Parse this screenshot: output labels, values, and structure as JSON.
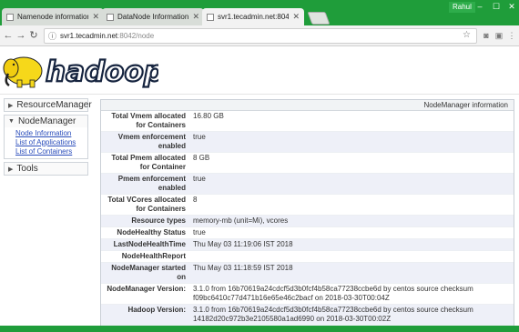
{
  "browser": {
    "tabs": [
      {
        "label": "Namenode information"
      },
      {
        "label": "DataNode Information"
      },
      {
        "label": "svr1.tecadmin.net:8042/n"
      }
    ],
    "user": "Rahul",
    "url_host": "svr1.tecadmin.net",
    "url_path": ":8042/node",
    "theme_color": "#1f9d3a"
  },
  "logo": {
    "text": "hadoop"
  },
  "sidebar": {
    "sections": [
      {
        "label": "ResourceManager",
        "expanded": false
      },
      {
        "label": "NodeManager",
        "expanded": true
      },
      {
        "label": "Tools",
        "expanded": false
      }
    ],
    "nodemanager_links": [
      {
        "label": "Node Information"
      },
      {
        "label": "List of Applications"
      },
      {
        "label": "List of Containers"
      }
    ]
  },
  "panel": {
    "title": "NodeManager information",
    "rows": [
      {
        "key": "Total Vmem allocated for Containers",
        "value": "16.80 GB"
      },
      {
        "key": "Vmem enforcement enabled",
        "value": "true"
      },
      {
        "key": "Total Pmem allocated for Container",
        "value": "8 GB"
      },
      {
        "key": "Pmem enforcement enabled",
        "value": "true"
      },
      {
        "key": "Total VCores allocated for Containers",
        "value": "8"
      },
      {
        "key": "Resource types",
        "value": "memory-mb (unit=Mi), vcores"
      },
      {
        "key": "NodeHealthy Status",
        "value": "true"
      },
      {
        "key": "LastNodeHealthTime",
        "value": "Thu May 03 11:19:06 IST 2018"
      },
      {
        "key": "NodeHealthReport",
        "value": ""
      },
      {
        "key": "NodeManager started on",
        "value": "Thu May 03 11:18:59 IST 2018"
      },
      {
        "key": "NodeManager Version:",
        "value": "3.1.0 from 16b70619a24cdcf5d3b0fcf4b58ca77238ccbe6d by centos source checksum f09bc6410c77d471b16e65e46c2bacf on 2018-03-30T00:04Z"
      },
      {
        "key": "Hadoop Version:",
        "value": "3.1.0 from 16b70619a24cdcf5d3b0fcf4b58ca77238ccbe6d by centos source checksum 14182d20c972b3e2105580a1ad6990 on 2018-03-30T00:02Z"
      }
    ]
  }
}
